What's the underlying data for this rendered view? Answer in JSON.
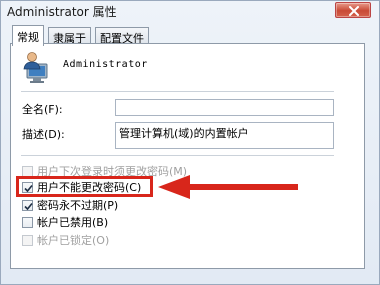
{
  "window": {
    "title": "Administrator 属性"
  },
  "tabs": [
    {
      "label": "常规",
      "active": true
    },
    {
      "label": "隶属于",
      "active": false
    },
    {
      "label": "配置文件",
      "active": false
    }
  ],
  "general": {
    "username": "Administrator",
    "fullname_label": "全名(F):",
    "fullname_value": "",
    "description_label": "描述(D):",
    "description_value": "管理计算机(域)的内置帐户"
  },
  "options": [
    {
      "label": "用户下次登录时须更改密码(M)",
      "checked": false,
      "disabled": true
    },
    {
      "label": "用户不能更改密码(C)",
      "checked": true,
      "disabled": false,
      "highlighted": true
    },
    {
      "label": "密码永不过期(P)",
      "checked": true,
      "disabled": false
    },
    {
      "label": "帐户已禁用(B)",
      "checked": false,
      "disabled": false
    },
    {
      "label": "帐户已锁定(O)",
      "checked": false,
      "disabled": true
    }
  ],
  "colors": {
    "highlight": "#d8261b",
    "close_button": "#c94a36"
  },
  "icons": [
    "close-icon",
    "user-computer-icon",
    "checkmark-icon",
    "red-arrow"
  ]
}
